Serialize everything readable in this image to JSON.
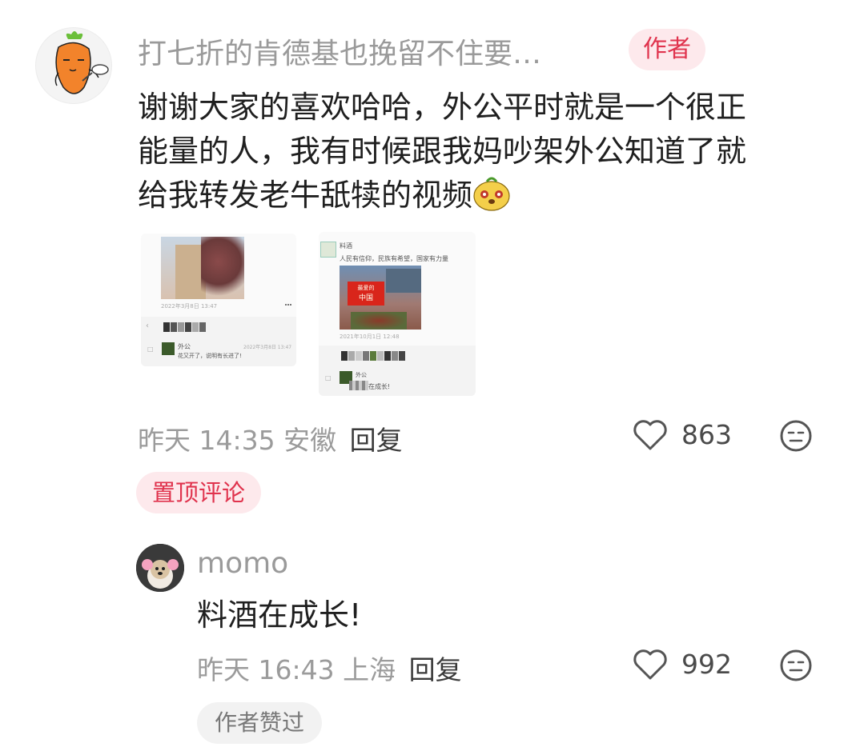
{
  "comment": {
    "username": "打七折的肯德基也挽留不住要…",
    "author_badge": "作者",
    "text_line1": "谢谢大家的喜欢哈哈，外公平时就是一个很正",
    "text_line2": "能量的人，我有时候跟我妈吵架外公知道了就",
    "text_line3": "给我转发老牛舐犊的视频",
    "time": "昨天 14:35",
    "location": "安徽",
    "reply_label": "回复",
    "like_count": "863",
    "pin_label": "置顶评论",
    "images": {
      "left": {
        "date": "2022年3月8日 13:47",
        "reply_name": "外公",
        "reply_time": "2022年3月8日 13:47",
        "reply_text": "花又开了，说明有长进了!"
      },
      "right": {
        "name": "料酒",
        "text": "人民有信仰，民族有希望，国家有力量",
        "screen_text_1": "最爱的",
        "screen_text_2": "中国",
        "date": "2021年10月1日 12:48",
        "reply_name": "外公",
        "reply_text": "在成长!"
      }
    }
  },
  "reply": {
    "username": "momo",
    "text": "料酒在成长!",
    "time": "昨天 16:43",
    "location": "上海",
    "reply_label": "回复",
    "like_count": "992",
    "author_liked": "作者赞过"
  },
  "icons": {
    "like": "heart-outline-icon",
    "dislike": "neutral-face-icon"
  },
  "colors": {
    "accent_red": "#e0334d",
    "badge_bg": "#fde9ec"
  }
}
